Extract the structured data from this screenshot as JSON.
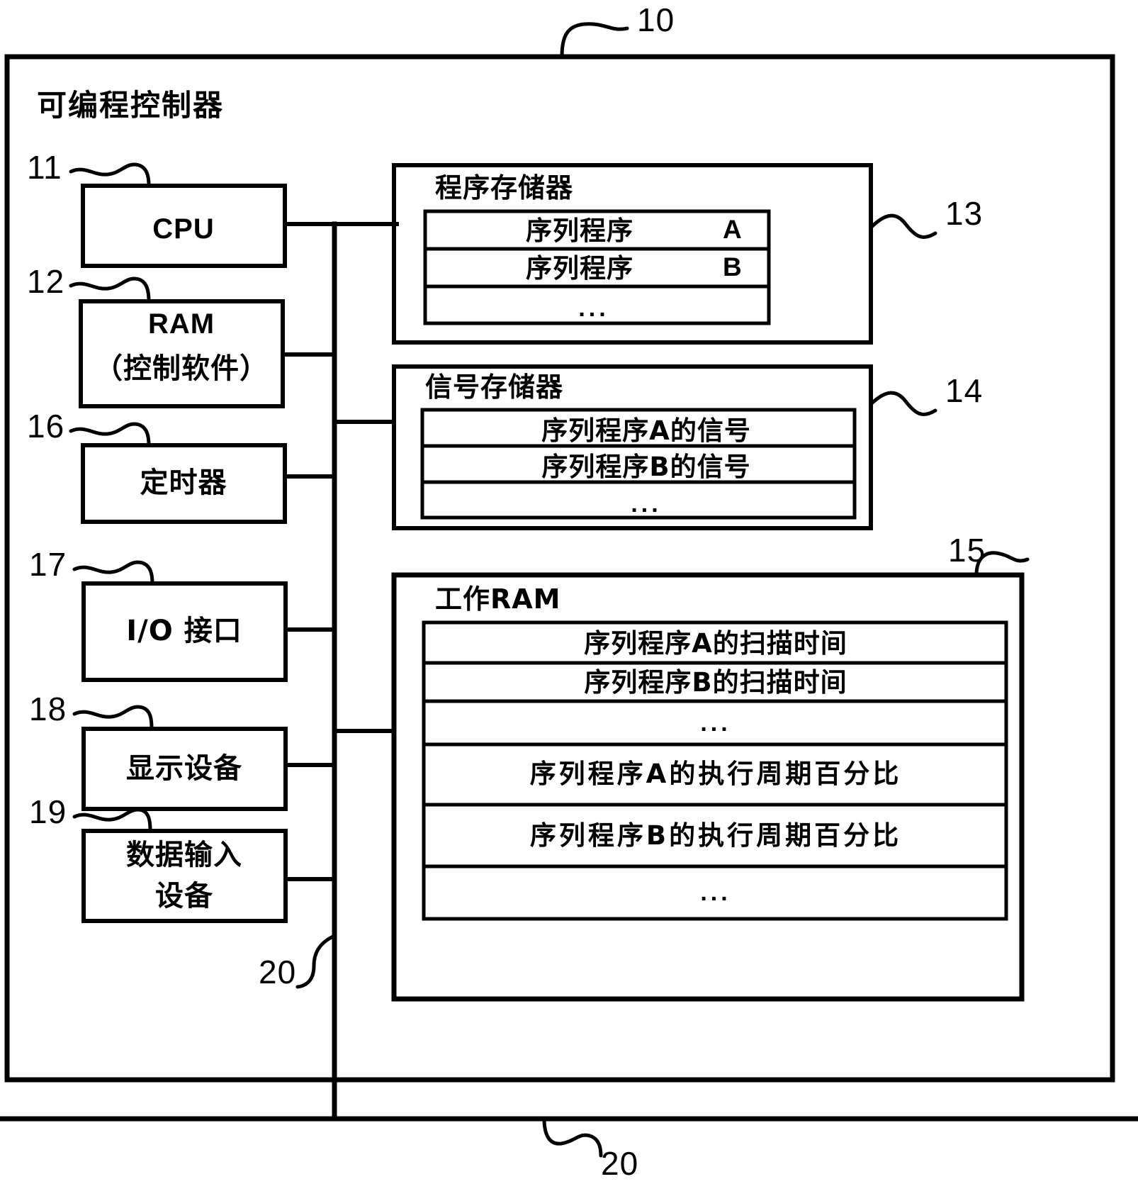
{
  "figure": {
    "outer_ref": "10",
    "bus_ref_middle": "20",
    "bus_ref_bottom": "20",
    "system_title": "可编程控制器"
  },
  "left_blocks": [
    {
      "ref": "11",
      "label": "CPU",
      "script": "latin"
    },
    {
      "ref": "12",
      "label_line1": "RAM",
      "label_line2": "（控制软件）",
      "script": "mixed"
    },
    {
      "ref": "16",
      "label": "定时器",
      "script": "cjk"
    },
    {
      "ref": "17",
      "label": "I/O  接口",
      "script": "cjk"
    },
    {
      "ref": "18",
      "label": "显示设备",
      "script": "cjk"
    },
    {
      "ref": "19",
      "label_line1": "数据输入",
      "label_line2": "设备",
      "script": "cjk"
    }
  ],
  "right_blocks": [
    {
      "ref": "13",
      "title": "程序存储器",
      "rows": [
        {
          "text": "序列程序",
          "suffix": "A"
        },
        {
          "text": "序列程序",
          "suffix": "B"
        },
        {
          "text": "...",
          "suffix": ""
        }
      ]
    },
    {
      "ref": "14",
      "title": "信号存储器",
      "rows": [
        {
          "text": "序列程序A的信号",
          "suffix": ""
        },
        {
          "text": "序列程序B的信号",
          "suffix": ""
        },
        {
          "text": "...",
          "suffix": ""
        }
      ]
    },
    {
      "ref": "15",
      "title": "工作RAM",
      "rows": [
        {
          "text": "序列程序A的扫描时间",
          "suffix": ""
        },
        {
          "text": "序列程序B的扫描时间",
          "suffix": ""
        },
        {
          "text": "...",
          "suffix": ""
        },
        {
          "text": "序列程序A的执行周期百分比",
          "suffix": ""
        },
        {
          "text": "序列程序B的执行周期百分比",
          "suffix": ""
        },
        {
          "text": "...",
          "suffix": ""
        }
      ]
    }
  ]
}
